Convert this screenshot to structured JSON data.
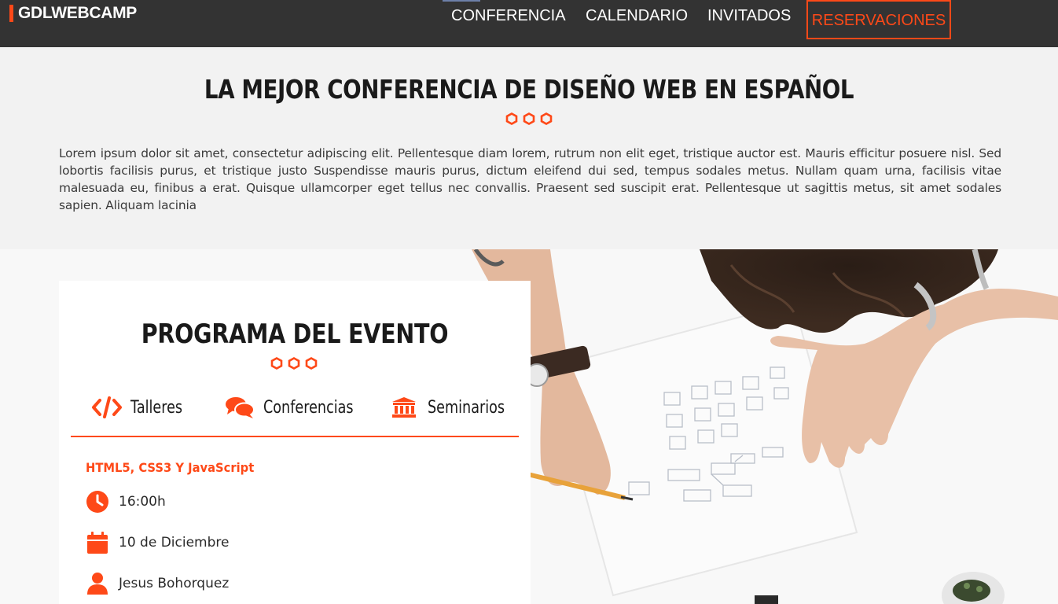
{
  "header": {
    "logo": "GDLWEBCAMP",
    "nav": [
      "CONFERENCIA",
      "CALENDARIO",
      "INVITADOS",
      "RESERVACIONES"
    ]
  },
  "intro": {
    "title": "LA MEJOR CONFERENCIA DE DISEÑO WEB EN ESPAÑOL",
    "text": "Lorem ipsum dolor sit amet, consectetur adipiscing elit. Pellentesque diam lorem, rutrum non elit eget, tristique auctor est. Mauris efficitur posuere nisl. Sed lobortis facilisis purus, et tristique justo Suspendisse mauris purus, dictum eleifend dui sed, tempus sodales metus. Nullam quam urna, facilisis vitae malesuada eu, finibus a erat. Quisque ullamcorper eget tellus nec convallis. Praesent sed suscipit erat. Pellentesque ut sagittis metus, sit amet sodales sapien. Aliquam lacinia"
  },
  "program": {
    "title": "PROGRAMA DEL EVENTO",
    "tabs": [
      {
        "label": "Talleres",
        "icon": "code-icon"
      },
      {
        "label": "Conferencias",
        "icon": "comments-icon"
      },
      {
        "label": "Seminarios",
        "icon": "university-icon"
      }
    ],
    "event": {
      "title": "HTML5, CSS3 Y JavaScript",
      "time": "16:00h",
      "date": "10 de Diciembre",
      "speaker": "Jesus Bohorquez"
    }
  },
  "colors": {
    "accent": "#fe4918",
    "header_bg": "#333333",
    "section_bg": "#f2f2f2"
  }
}
